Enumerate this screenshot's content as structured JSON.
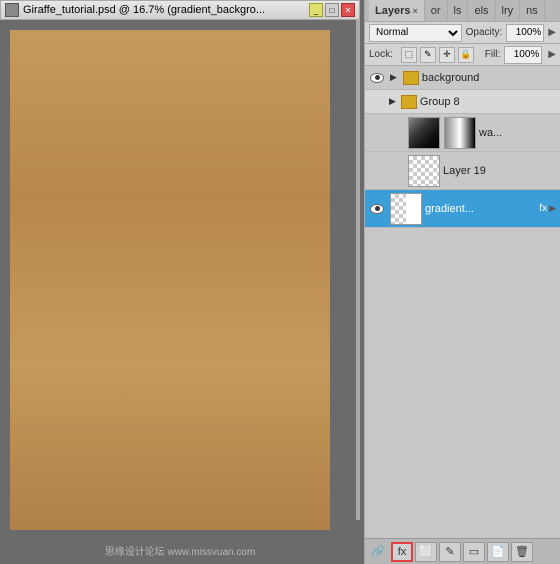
{
  "titlebar": {
    "title": "Giraffe_tutorial.psd @ 16.7% (gradient_backgro...",
    "minimize_label": "_",
    "maximize_label": "□",
    "close_label": "✕"
  },
  "layers_panel": {
    "title": "Layers",
    "tabs": [
      {
        "label": "Layers",
        "shortcut": "×"
      },
      {
        "label": "or"
      },
      {
        "label": "ls"
      },
      {
        "label": "els"
      },
      {
        "label": "lry"
      },
      {
        "label": "ns"
      }
    ],
    "blend_mode": "Normal",
    "opacity_label": "Opacity:",
    "opacity_value": "100%",
    "lock_label": "Lock:",
    "fill_label": "Fill:",
    "fill_value": "100%",
    "layers": [
      {
        "id": "background",
        "name": "background",
        "visible": true,
        "type": "folder-closed",
        "indent": false
      },
      {
        "id": "group8",
        "name": "Group 8",
        "visible": false,
        "type": "group",
        "indent": false
      },
      {
        "id": "wa",
        "name": "wa...",
        "visible": false,
        "type": "layer-gradient",
        "indent": true
      },
      {
        "id": "layer19",
        "name": "Layer 19",
        "visible": false,
        "type": "layer-checker",
        "indent": true
      },
      {
        "id": "gradient",
        "name": "gradient...",
        "visible": true,
        "type": "layer-white",
        "selected": true,
        "has_fx": true,
        "indent": false
      }
    ],
    "toolbar": {
      "link_icon": "🔗",
      "fx_icon": "fx",
      "mask_icon": "⬜",
      "brush_icon": "✎",
      "rect_icon": "▭",
      "folder_icon": "📁",
      "delete_icon": "🗑"
    }
  },
  "watermark": "思缘设计论坛 www.missvuan.com"
}
